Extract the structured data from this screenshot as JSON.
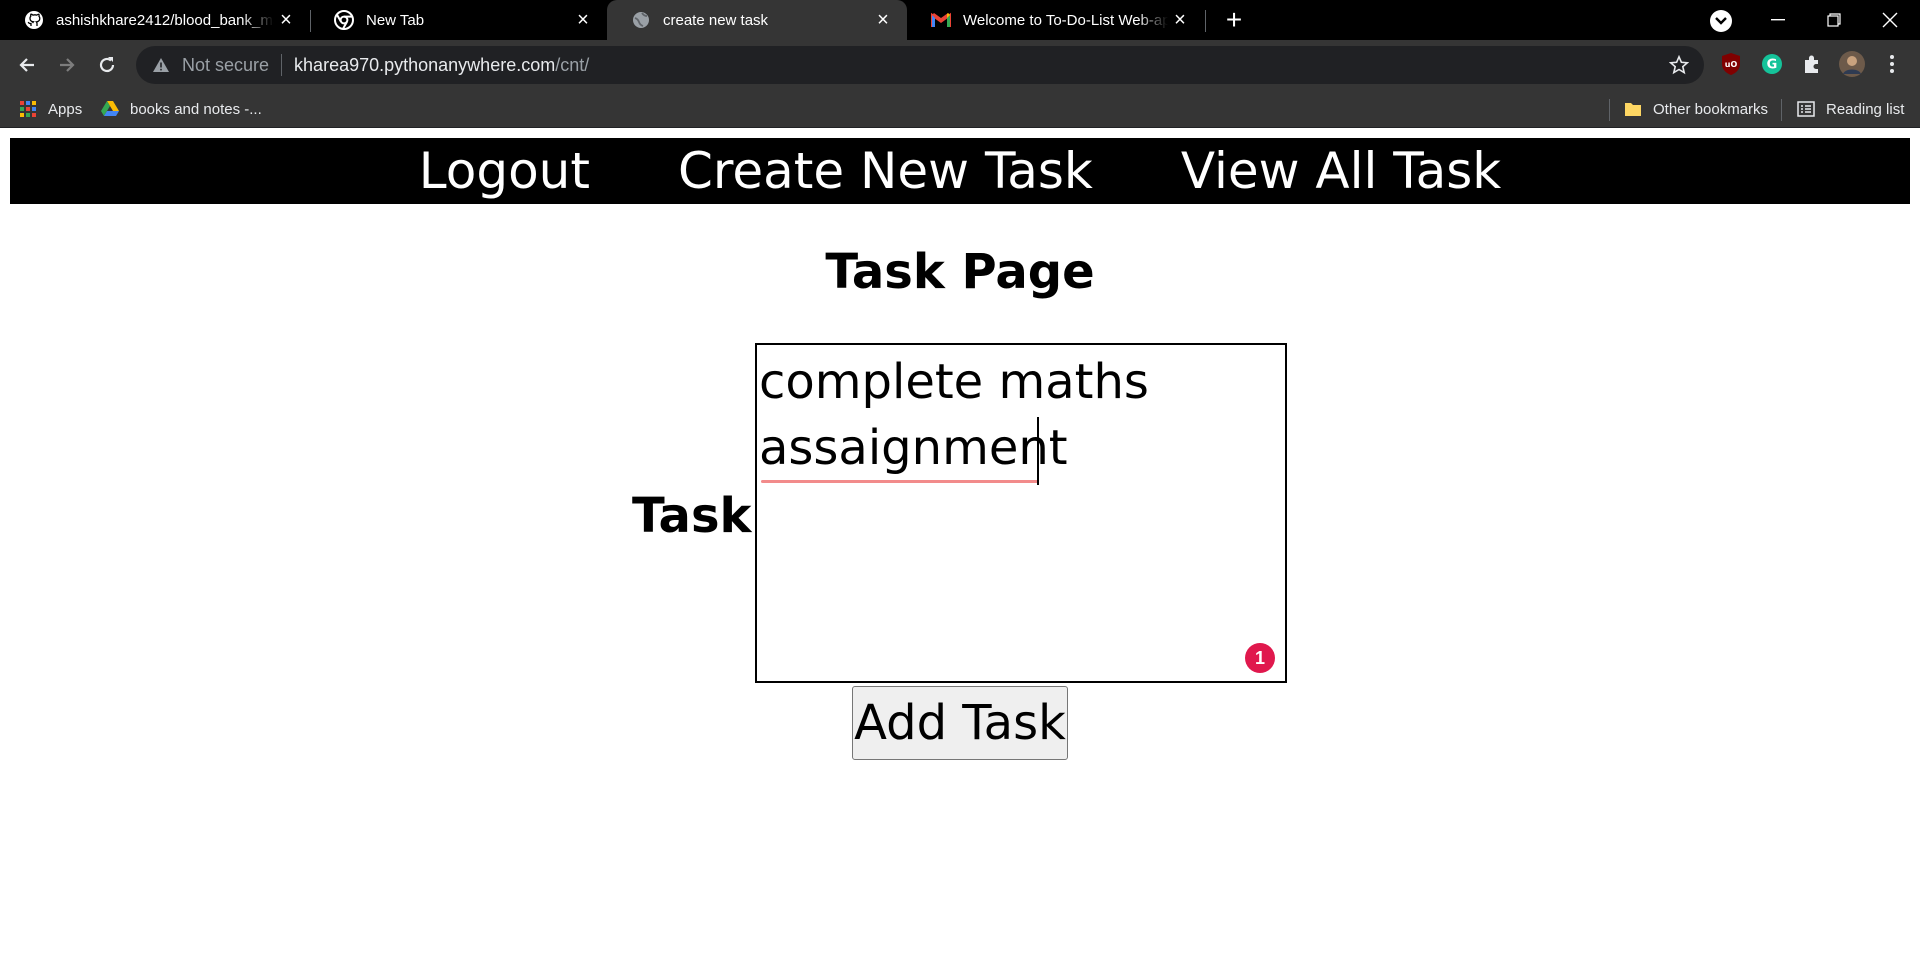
{
  "browser": {
    "tabs": [
      {
        "title": "ashishkhare2412/blood_bank_ma",
        "icon": "github-icon",
        "active": false
      },
      {
        "title": "New Tab",
        "icon": "chrome-icon",
        "active": false
      },
      {
        "title": "create new task",
        "icon": "globe-icon",
        "active": true
      },
      {
        "title": "Welcome to To-Do-List Web-app",
        "icon": "gmail-icon",
        "active": false
      }
    ],
    "new_tab_label": "+",
    "address": {
      "security_label": "Not secure",
      "host": "kharea970.pythonanywhere.com",
      "path": "/cnt/"
    },
    "extensions": [
      "ublock-icon",
      "grammarly-icon",
      "extensions-puzzle-icon",
      "profile-avatar"
    ],
    "bookmarks": {
      "apps_label": "Apps",
      "items": [
        {
          "label": "books and notes -...",
          "icon": "google-drive-icon"
        }
      ],
      "other_label": "Other bookmarks",
      "reading_list_label": "Reading list"
    }
  },
  "site": {
    "nav": {
      "logout": "Logout",
      "create": "Create New Task",
      "view_all": "View All Task"
    },
    "heading": "Task Page",
    "form": {
      "task_label": "Task:",
      "task_value": "complete maths assaignment",
      "grammar_badge": "1",
      "submit_label": "Add Task"
    }
  },
  "colors": {
    "tab_strip": "#000000",
    "toolbar": "#353535",
    "site_nav": "#000000",
    "grammarly_badge": "#e0184d"
  }
}
